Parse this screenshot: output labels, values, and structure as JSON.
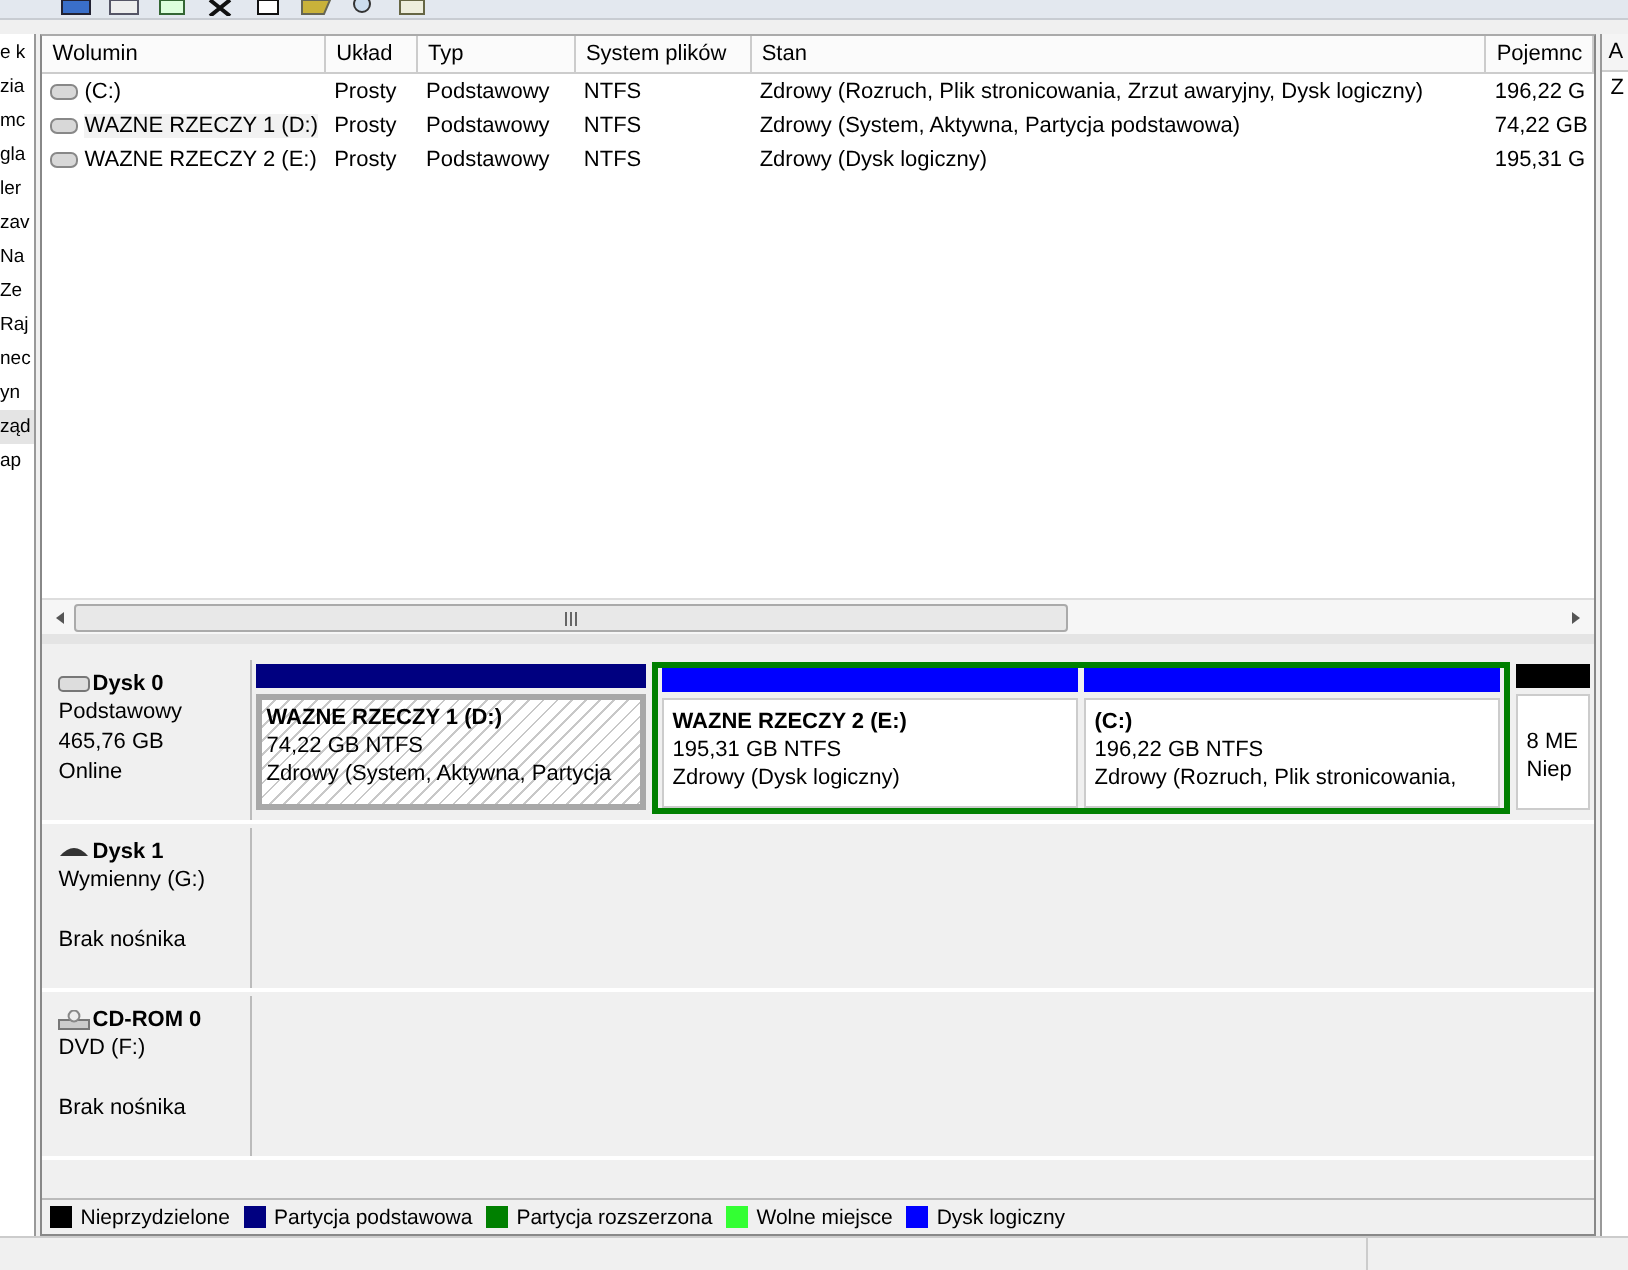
{
  "navigation": {
    "items": [
      {
        "label": "e k",
        "selected": false
      },
      {
        "label": "zia",
        "selected": false
      },
      {
        "label": "mc",
        "selected": false
      },
      {
        "label": "gla",
        "selected": false
      },
      {
        "label": "ler",
        "selected": false
      },
      {
        "label": "zav",
        "selected": false
      },
      {
        "label": "Na",
        "selected": false
      },
      {
        "label": "Ze",
        "selected": false
      },
      {
        "label": "Raj",
        "selected": false
      },
      {
        "label": "nec",
        "selected": false
      },
      {
        "label": "yn",
        "selected": false
      },
      {
        "label": "ząd",
        "selected": true
      },
      {
        "label": "ap",
        "selected": false
      }
    ]
  },
  "volume_table": {
    "columns": [
      "Wolumin",
      "Układ",
      "Typ",
      "System plików",
      "Stan",
      "Pojemnc"
    ],
    "rows": [
      {
        "selected": false,
        "cells": [
          "(C:)",
          "Prosty",
          "Podstawowy",
          "NTFS",
          "Zdrowy (Rozruch, Plik stronicowania, Zrzut awaryjny, Dysk logiczny)",
          "196,22 G"
        ]
      },
      {
        "selected": true,
        "cells": [
          "WAZNE RZECZY 1 (D:)",
          "Prosty",
          "Podstawowy",
          "NTFS",
          "Zdrowy (System, Aktywna, Partycja podstawowa)",
          "74,22 GB"
        ]
      },
      {
        "selected": false,
        "cells": [
          "WAZNE RZECZY 2 (E:)",
          "Prosty",
          "Podstawowy",
          "NTFS",
          "Zdrowy (Dysk logiczny)",
          "195,31 G"
        ]
      }
    ]
  },
  "disks": [
    {
      "name": "Dysk 0",
      "kind": "disk",
      "type": "Podstawowy",
      "size": "465,76 GB",
      "status": "Online",
      "partitions": [
        {
          "kind": "primary",
          "color": "#000080",
          "selected": true,
          "title": "WAZNE RZECZY 1  (D:)",
          "size": "74,22 GB NTFS",
          "status": "Zdrowy (System, Aktywna, Partycja"
        },
        {
          "kind": "extended",
          "color": "#008000",
          "children": [
            {
              "kind": "logical",
              "color": "#0000ff",
              "selected": false,
              "title": "WAZNE RZECZY 2  (E:)",
              "size": "195,31 GB NTFS",
              "status": "Zdrowy (Dysk logiczny)"
            },
            {
              "kind": "logical",
              "color": "#0000ff",
              "selected": false,
              "title": " (C:)",
              "size": "196,22 GB NTFS",
              "status": "Zdrowy (Rozruch, Plik stronicowania,"
            }
          ]
        },
        {
          "kind": "unallocated",
          "color": "#000000",
          "selected": false,
          "size": "8 ME",
          "status": "Niep"
        }
      ]
    },
    {
      "name": "Dysk 1",
      "kind": "removable",
      "type": "Wymienny (G:)",
      "status": "Brak nośnika"
    },
    {
      "name": "CD-ROM 0",
      "kind": "cdrom",
      "type": "DVD (F:)",
      "status": "Brak nośnika"
    }
  ],
  "legend": [
    {
      "label": "Nieprzydzielone",
      "color": "#000000"
    },
    {
      "label": "Partycja podstawowa",
      "color": "#000080"
    },
    {
      "label": "Partycja rozszerzona",
      "color": "#008000"
    },
    {
      "label": "Wolne miejsce",
      "color": "#33ff33"
    },
    {
      "label": "Dysk logiczny",
      "color": "#0000ff"
    }
  ],
  "actions_panel": {
    "header": "A",
    "items": [
      "Z"
    ]
  }
}
